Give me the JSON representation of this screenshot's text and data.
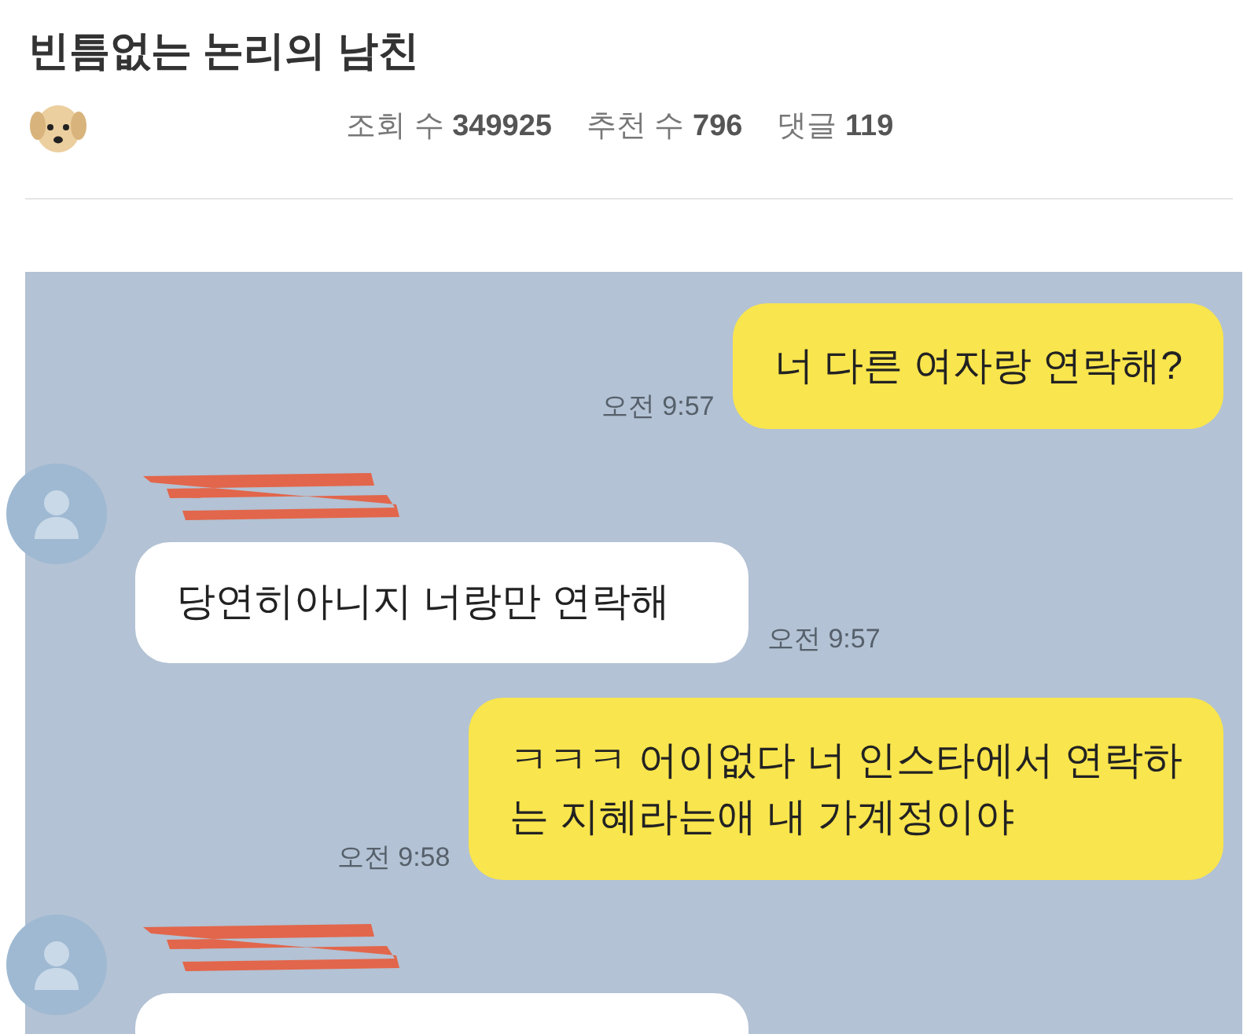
{
  "post": {
    "title": "빈틈없는 논리의 남친",
    "stats": [
      {
        "label": "조회 수",
        "value": "349925"
      },
      {
        "label": "추천 수",
        "value": "796"
      },
      {
        "label": "댓글",
        "value": "119"
      }
    ]
  },
  "chat": {
    "messages": [
      {
        "kind": "sent",
        "lines": [
          "너 다른 여자랑 연락해?"
        ],
        "time": "오전 9:57"
      },
      {
        "kind": "received",
        "lines": [
          "당연히아니지 너랑만 연락해"
        ],
        "time": "오전 9:57"
      },
      {
        "kind": "sent",
        "lines": [
          "ㅋㅋㅋ 어이없다 너 인스타에서 연락하",
          "는 지혜라는애 내 가계정이야"
        ],
        "time": "오전 9:58"
      },
      {
        "kind": "received"
      }
    ]
  }
}
